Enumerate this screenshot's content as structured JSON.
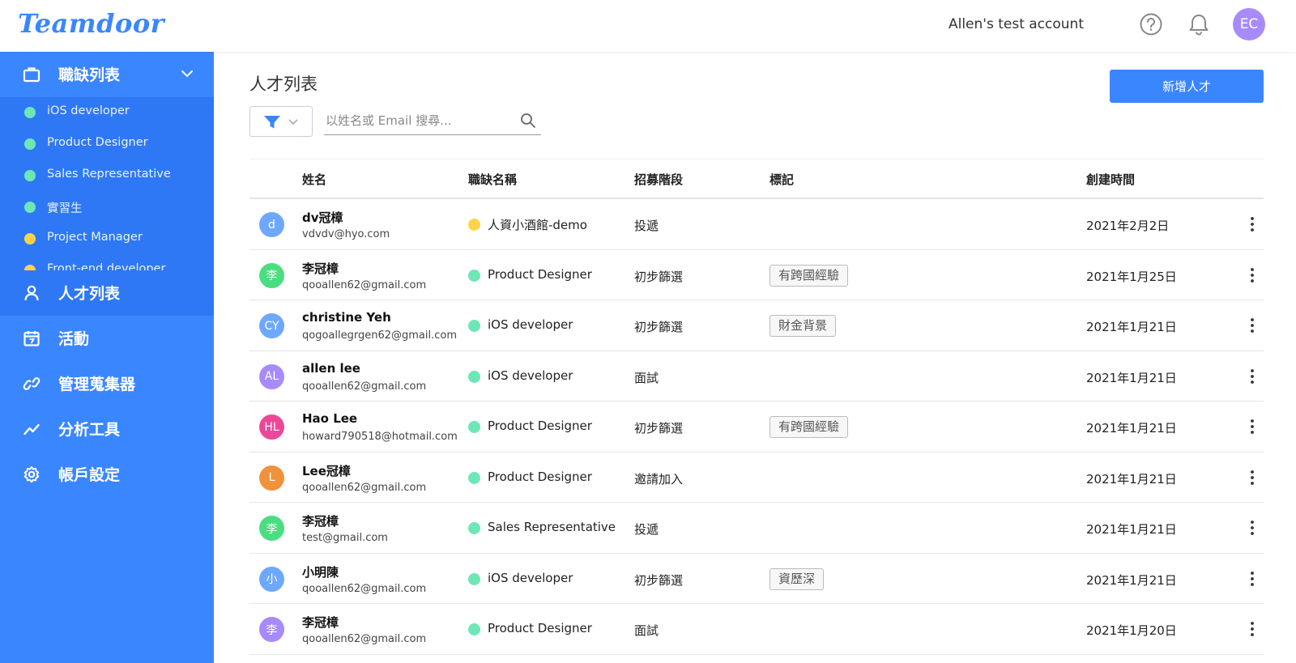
{
  "header": {
    "logo": "Teamdoor",
    "account_name": "Allen's test account",
    "avatar_initials": "EC",
    "avatar_color": "#a78bfa"
  },
  "sidebar": {
    "jobs_label": "職缺列表",
    "jobs": [
      {
        "label": "iOS developer",
        "color": "#6ee7b7"
      },
      {
        "label": "Product Designer",
        "color": "#6ee7b7"
      },
      {
        "label": "Sales Representative",
        "color": "#6ee7b7"
      },
      {
        "label": "實習生",
        "color": "#6ee7b7"
      },
      {
        "label": "Project Manager",
        "color": "#fcd34d"
      },
      {
        "label": "Front-end developer",
        "color": "#fcd34d"
      }
    ],
    "items": [
      {
        "label": "人才列表",
        "icon": "user-icon",
        "active": true
      },
      {
        "label": "活動",
        "icon": "calendar-icon",
        "active": false
      },
      {
        "label": "管理蒐集器",
        "icon": "link-icon",
        "active": false
      },
      {
        "label": "分析工具",
        "icon": "chart-line-icon",
        "active": false
      },
      {
        "label": "帳戶設定",
        "icon": "gear-icon",
        "active": false
      }
    ]
  },
  "main": {
    "title": "人才列表",
    "add_button": "新增人才",
    "search_placeholder": "以姓名或 Email 搜尋...",
    "columns": [
      "姓名",
      "職缺名稱",
      "招募階段",
      "標記",
      "創建時間"
    ],
    "rows": [
      {
        "initial": "d",
        "avatar_color": "#6ea8fe",
        "name": "dv冠樟",
        "email": "vdvdv@hyo.com",
        "job": "人資小酒館-demo",
        "job_color": "#fcd34d",
        "stage": "投遞",
        "tag": "",
        "date": "2021年2月2日"
      },
      {
        "initial": "李",
        "avatar_color": "#4ade80",
        "name": "李冠樟",
        "email": "qooallen62@gmail.com",
        "job": "Product Designer",
        "job_color": "#6ee7b7",
        "stage": "初步篩選",
        "tag": "有跨國經驗",
        "date": "2021年1月25日"
      },
      {
        "initial": "CY",
        "avatar_color": "#6ea8fe",
        "name": "christine Yeh",
        "email": "qogoallegrgen62@gmail.com",
        "job": "iOS developer",
        "job_color": "#6ee7b7",
        "stage": "初步篩選",
        "tag": "財金背景",
        "date": "2021年1月21日"
      },
      {
        "initial": "AL",
        "avatar_color": "#a78bfa",
        "name": "allen lee",
        "email": "qooallen62@gmail.com",
        "job": "iOS developer",
        "job_color": "#6ee7b7",
        "stage": "面試",
        "tag": "",
        "date": "2021年1月21日"
      },
      {
        "initial": "HL",
        "avatar_color": "#ec4899",
        "name": "Hao Lee",
        "email": "howard790518@hotmail.com",
        "job": "Product Designer",
        "job_color": "#6ee7b7",
        "stage": "初步篩選",
        "tag": "有跨國經驗",
        "date": "2021年1月21日"
      },
      {
        "initial": "L",
        "avatar_color": "#f0923b",
        "name": "Lee冠樟",
        "email": "qooallen62@gmail.com",
        "job": "Product Designer",
        "job_color": "#6ee7b7",
        "stage": "邀請加入",
        "tag": "",
        "date": "2021年1月21日"
      },
      {
        "initial": "李",
        "avatar_color": "#4ade80",
        "name": "李冠樟",
        "email": "test@gmail.com",
        "job": "Sales Representative",
        "job_color": "#6ee7b7",
        "stage": "投遞",
        "tag": "",
        "date": "2021年1月21日"
      },
      {
        "initial": "小",
        "avatar_color": "#6ea8fe",
        "name": "小明陳",
        "email": "qooallen62@gmail.com",
        "job": "iOS developer",
        "job_color": "#6ee7b7",
        "stage": "初步篩選",
        "tag": "資歷深",
        "date": "2021年1月21日"
      },
      {
        "initial": "李",
        "avatar_color": "#a78bfa",
        "name": "李冠樟",
        "email": "qooallen62@gmail.com",
        "job": "Product Designer",
        "job_color": "#6ee7b7",
        "stage": "面試",
        "tag": "",
        "date": "2021年1月20日"
      }
    ]
  },
  "colors": {
    "primary": "#3a86ff",
    "sidebar_active": "#2f78f5"
  }
}
